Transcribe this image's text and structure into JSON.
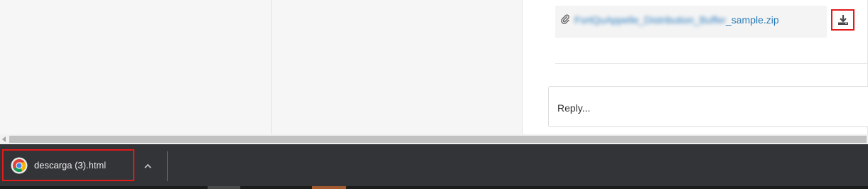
{
  "attachment": {
    "filename_blurred": "FortQuAppelle_Distribution_Buffer",
    "filename_suffix": "_sample.zip",
    "paperclip_icon": "paperclip-icon",
    "download_icon": "download-icon"
  },
  "reply": {
    "placeholder": "Reply..."
  },
  "download_shelf": {
    "item": {
      "filename": "descarga (3).html",
      "icon": "chrome-icon"
    },
    "expand_icon": "chevron-up-icon"
  },
  "colors": {
    "link": "#2b7bb9",
    "highlight": "#e11a1a",
    "shelf_bg": "#333437"
  }
}
